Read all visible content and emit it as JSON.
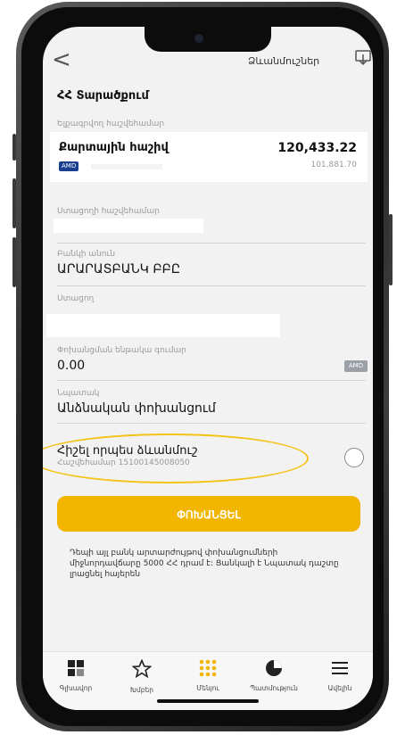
{
  "header": {
    "back_glyph": "<",
    "templates_label": "Ձևանմուշներ",
    "download_icon": "download-icon",
    "title": "ՀՀ Տարածքում"
  },
  "from_account": {
    "label": "Ելքագրվող հաշվեհամար",
    "name": "Քարտային հաշիվ",
    "currency": "AMD",
    "balance": "120,433.22",
    "secondary_balance": "101,881.70"
  },
  "form": {
    "recipient_account_label": "Ստացողի հաշվեհամար",
    "bank_name_label": "Բանկի անուն",
    "bank_name_value": "ԱՐԱՐԱՏԲԱՆԿ ԲԲԸ",
    "recipient_label": "Ստացող",
    "amount_label": "Փոխանցման ենթակա գումար",
    "amount_value": "0.00",
    "amount_currency": "AMD",
    "purpose_label": "Նպատակ",
    "purpose_value": "Անձնական փոխանցում"
  },
  "save_template": {
    "title": "Հիշել որպես ձևանմուշ",
    "subtitle": "Հաշվեհամար 15100145008050",
    "checked": false
  },
  "transfer_button": "ՓՈԽԱՆՑԵԼ",
  "note": "Դեպի այլ բանկ արտարժույթով փոխանցումների միջնորդավճարը 5000 ՀՀ դրամ է: Ցանկալի է Նպատակ դաշտը լրացնել հայերեն",
  "tabbar": [
    {
      "label": "Գլխավոր",
      "icon": "grid-icon"
    },
    {
      "label": "Խմբեր",
      "icon": "star-icon"
    },
    {
      "label": "Մենյու",
      "icon": "dots-menu-icon"
    },
    {
      "label": "Պատմություն",
      "icon": "history-icon"
    },
    {
      "label": "Ավելին",
      "icon": "hamburger-icon"
    }
  ],
  "colors": {
    "accent": "#f2b600",
    "chip_blue": "#1b3f8f",
    "highlight_oval": "#f3c318"
  }
}
